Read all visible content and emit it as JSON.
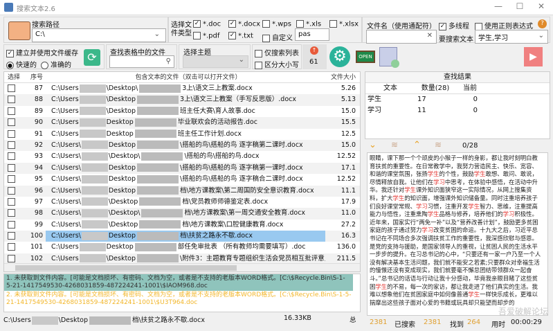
{
  "window": {
    "title": "搜索文本2.6",
    "minimize": "—",
    "maximize": "☐",
    "close": "✕"
  },
  "search_path": {
    "label": "搜索路径",
    "value": "C:\\"
  },
  "file_types": {
    "label": "选择文件类型",
    "items": [
      {
        "label": "*.doc",
        "checked": true
      },
      {
        "label": "*.docx",
        "checked": true
      },
      {
        "label": "*.wps",
        "checked": false
      },
      {
        "label": "*.xls",
        "checked": false
      },
      {
        "label": "*.xlsx",
        "checked": false
      },
      {
        "label": "*.pdf",
        "checked": false
      },
      {
        "label": "*.txt",
        "checked": true
      },
      {
        "label": "自定义",
        "checked": false
      }
    ],
    "custom_value": "pas"
  },
  "filename": {
    "label": "文件名（使用通配符）",
    "value": ""
  },
  "multithread": {
    "label": "多线程",
    "checked": true
  },
  "regex": {
    "label": "使用正则表达式",
    "checked": false
  },
  "search_text": {
    "label": "要搜索文本",
    "value": "学生,学习"
  },
  "cache": {
    "label": "建立并使用文件缓存",
    "checked": true,
    "fast": "快速的",
    "accurate": "准确的",
    "selected": "fast"
  },
  "find_in_table": {
    "label": "查找表格中的文件",
    "value": ""
  },
  "theme": {
    "label": "选择主题",
    "value": ""
  },
  "only_list": {
    "label": "仅搜索列表",
    "checked": false
  },
  "case": {
    "label": "区分大小写",
    "checked": false
  },
  "counter": "61",
  "open_sign": "OPEN",
  "table": {
    "headers": [
      "选择",
      "序号",
      "包含文本的文件（双击可以打开文件）",
      "文件大小"
    ],
    "selected_index": 100,
    "rows": [
      {
        "n": "87",
        "a": "C:\\Users",
        "b": "\\Desktop\\",
        "c": "3上\\语文三上教案.docx",
        "size": "5.26"
      },
      {
        "n": "88",
        "a": "C:\\Users",
        "b": "\\Desktop",
        "c": "3上\\语文三上教案（手写反思版）.docx",
        "size": "5.13"
      },
      {
        "n": "89",
        "a": "C:\\Users",
        "b": "\\Desktop",
        "c": "班主任大赛\\育人故事.doc",
        "size": "15.0"
      },
      {
        "n": "90",
        "a": "C:\\Users",
        "b": "Desktop",
        "c": "毕业联欢会的活动报告.doc",
        "size": "15.5"
      },
      {
        "n": "91",
        "a": "C:\\Users",
        "b": "Desktop",
        "c": "班主任工作计划.docx",
        "size": "12.5"
      },
      {
        "n": "92",
        "a": "C:\\Users\\",
        "b": "Desktop",
        "c": "\\搭船的鸟\\搭船的鸟 逐字稿第二课时.docx",
        "size": "15.0"
      },
      {
        "n": "93",
        "a": "C:\\Users\\",
        "b": "\\Desktop\\",
        "c": "\\搭船的鸟\\搭船的鸟.docx",
        "size": "12.52"
      },
      {
        "n": "94",
        "a": "C:\\Users\\",
        "b": "Desktop",
        "c": "\\搭船的鸟\\搭船的鸟 逐字稿第一课时.docx",
        "size": "17.1"
      },
      {
        "n": "95",
        "a": "C:\\Users\\",
        "b": "Desktop",
        "c": "\\搭船的鸟\\搭船的鸟   逐字稿合二课时.docx",
        "size": "12.52"
      },
      {
        "n": "96",
        "a": "C:\\Users\\",
        "b": "Desktop",
        "c": "档\\地方课教案\\第二周国防安全意识教育.docx",
        "size": "11.1"
      },
      {
        "n": "97",
        "a": "C:\\Users\\",
        "b": "\\Desktop",
        "c": "档\\党员教师师德鉴定表.docx",
        "size": "17.9"
      },
      {
        "n": "98",
        "a": "C:\\Users\\",
        "b": "\\Desktop\\",
        "c": "档\\地方课教案\\第一周交通安全教育.docx",
        "size": "11.0"
      },
      {
        "n": "99",
        "a": "C:\\Users\\",
        "b": "\\Desktop",
        "c": "档\\地方课教案\\口腔健康教育.docx",
        "size": "27.2"
      },
      {
        "n": "100",
        "a": "C:\\Users\\",
        "b": "Desktop",
        "c": "档\\扶贫之路永不歇.docx",
        "size": "16.3"
      },
      {
        "n": "101",
        "a": "C:\\Users",
        "b": "Desktop",
        "c": "部任免审批表 （所有教师均需要填写）.doc",
        "size": "136.0"
      },
      {
        "n": "102",
        "a": "C:\\Users",
        "b": "\\Desktop",
        "c": "\\附件3：主题教育专题组织生活会党员相互批评意见清单(2).d...",
        "size": "211.5"
      }
    ]
  },
  "log": [
    {
      "text": "1. 未获取到文件内容。[可能是文档损坏、有密码、文档为空，或者是不支持的老版本WORD格式。[C:\\$Recycle.Bin\\S-1-5-21-1417549530-4268031859-487224241-1001\\$IAOM968.doc",
      "color": "#333333",
      "bg": "#8fc4bc"
    },
    {
      "text": "2. 未获取到文件内容。[可能是文档损坏、有密码、文档为空，或者是不支持的老版本WORD格式。[C:\\$Recycle.Bin\\S-1-5-21-1417549530-4268031859-487224241-1001\\$U3T964.doc",
      "color": "#f2b62a",
      "bg": "#ffffff"
    }
  ],
  "results": {
    "title": "查找结果",
    "headers": [
      "文本",
      "数量(28)",
      "当前"
    ],
    "rows": [
      {
        "text": "学生",
        "count": "17",
        "current": "0"
      },
      {
        "text": "学习",
        "count": "11",
        "current": "0"
      }
    ],
    "position": "0/28"
  },
  "preview": {
    "segments": [
      {
        "t": "眼睛，课下那一个个顽皮的小猴子一样的身影，都让我时刻明白教育扶贫的重要性。在日常教学中，我努力营造民主、快乐、宽容、和谐的课堂氛围，张扬"
      },
      {
        "t": "学生",
        "h": true
      },
      {
        "t": "的个性，鼓励"
      },
      {
        "t": "学生",
        "h": true
      },
      {
        "t": "敢想、敢问、敢说，尽情释放自我。让他们在"
      },
      {
        "t": "学习",
        "h": true
      },
      {
        "t": "中思考，在体验中感悟，在活动中升华。我还针对"
      },
      {
        "t": "学生",
        "h": true
      },
      {
        "t": "课外知识面狭窄这一实际情况，从网上搜集资料，扩大"
      },
      {
        "t": "学生",
        "h": true
      },
      {
        "t": "的知识面，增强课外知识储备量。同时注重培养孩子们良好课堂常规、"
      },
      {
        "t": "学习",
        "h": true
      },
      {
        "t": "习惯，注重开发"
      },
      {
        "t": "学生",
        "h": true
      },
      {
        "t": "智力、思维，注重提高能力与悟性，注重熏陶"
      },
      {
        "t": "学生",
        "h": true
      },
      {
        "t": "品格与修养，培养他们的"
      },
      {
        "t": "学习",
        "h": true
      },
      {
        "t": "积极性。近年来，国家实行“两免一补”以及“营养改善计划”，鼓励更多贫困家庭的孩子通过努力"
      },
      {
        "t": "学习",
        "h": true
      },
      {
        "t": "改变贫困的命运。十九大之后，习近平总书记在不同场合多次强调扶贫工作的重要性，我深感欣慰与感恩。是党的支持与援助，是国家领导人的重视，让贫困人民的生活水平一步步的提升。在习总书记的心中，“只要还有一家一户乃至一个人没有解决基本生活问题，我们就不能安之若素;只要群众对幸福生活的憧憬还没有变成现实，我们就要毫不懈怠团结带领群众一起奋斗。”总书记的话语与行动让我十分感动，毕竟我亲眼目睹了这些贫困"
      },
      {
        "t": "学生",
        "h": true
      },
      {
        "t": "的不易，每一次的家访，都让我走进了他们真实的生活。我难以想象他们在贫困家庭中如何像普通"
      },
      {
        "t": "学生",
        "h": true
      },
      {
        "t": "一样快乐成长，更难以揣摩出这些孩子面对心爱的书籍或玩具却只能望而却步的"
      }
    ]
  },
  "pathbar": {
    "a": "C:\\Users",
    "b": "\\Desktop",
    "c": "档\\扶贫之路永不歇.docx",
    "size": "16.33KB",
    "total_label": "总"
  },
  "status": {
    "total": "2381",
    "searched_label": "已搜索",
    "searched": "2381",
    "found_label": "找到",
    "found": "264",
    "time_label": "用时",
    "time": "00:00:29"
  },
  "watermark": "吾爱破解论坛",
  "colors": {
    "accent_orange": "#e0a030",
    "highlight": "#e53935",
    "selection": "#99c9f0",
    "play": "#f08080",
    "gear": "#2bb39a"
  }
}
